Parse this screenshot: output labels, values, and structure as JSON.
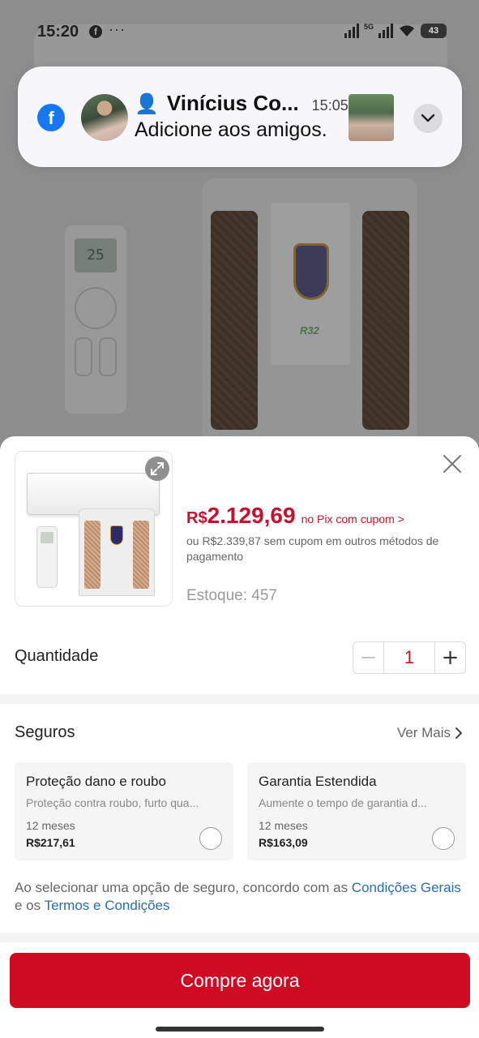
{
  "status_bar": {
    "time": "15:20",
    "dots": "···",
    "network": "5G",
    "battery": "43"
  },
  "background": {
    "remote_display": "25"
  },
  "notification": {
    "app_icon": "f",
    "sender": "Vinícius Co...",
    "time": "15:05",
    "message": "Adicione aos amigos."
  },
  "sheet": {
    "price": {
      "currency": "R$",
      "value": "2.129,69",
      "note": "no Pix com cupom >"
    },
    "alt_price": "ou R$2.339,87 sem cupom em outros métodos de pagamento",
    "stock": "Estoque: 457",
    "quantity": {
      "label": "Quantidade",
      "value": "1",
      "minus": "−",
      "plus": "+"
    },
    "insurance": {
      "title": "Seguros",
      "see_more": "Ver Mais",
      "cards": [
        {
          "title": "Proteção dano e roubo",
          "description": "Proteção contra roubo, furto qua...",
          "term": "12 meses",
          "price": "R$217,61"
        },
        {
          "title": "Garantia Estendida",
          "description": "Aumente o tempo de garantia d...",
          "term": "12 meses",
          "price": "R$163,09"
        }
      ]
    },
    "terms": {
      "prefix": "Ao selecionar uma opção de seguro, concordo com as ",
      "link1": "Condições Gerais",
      "middle": " e os ",
      "link2": "Termos e Condições"
    },
    "buy_button": "Compre agora"
  },
  "colors": {
    "accent_red": "#c8102e",
    "buy_button": "#cf0a23",
    "link_blue": "#2b6cb0",
    "facebook_blue": "#1877f2"
  }
}
